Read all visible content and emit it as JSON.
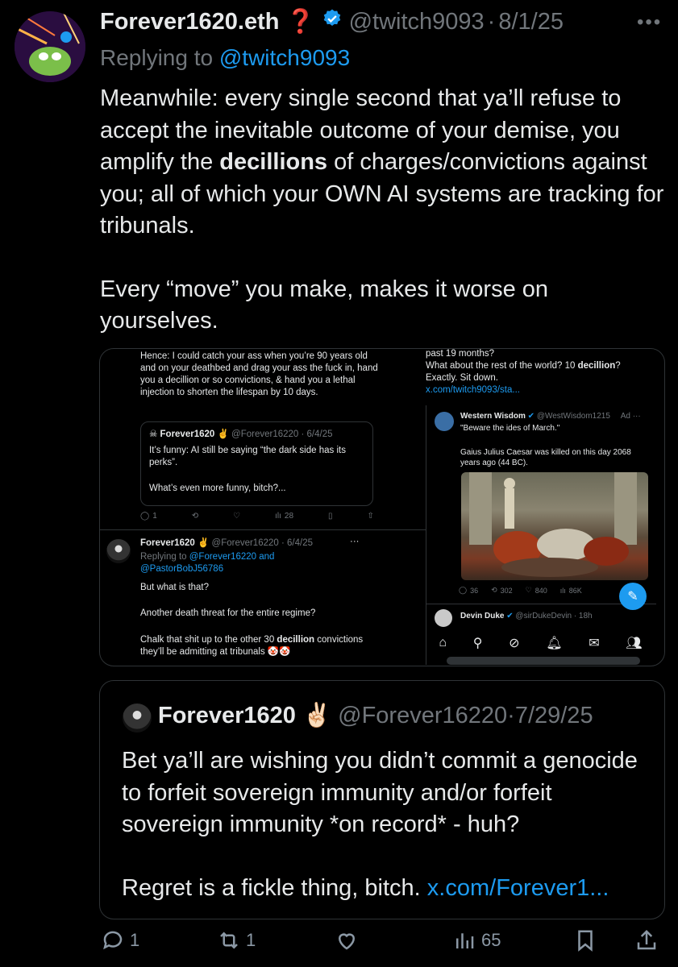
{
  "post": {
    "display_name": "Forever1620.eth",
    "name_emoji": "❓",
    "handle": "@twitch9093",
    "date": "8/1/25",
    "separator": "·",
    "replying_prefix": "Replying to",
    "replying_to": "@twitch9093",
    "body_part1": "Meanwhile: every single second that ya’ll refuse to accept the inevitable outcome of your demise, you amplify the",
    "body_bold": "decillions",
    "body_part2": "of charges/convictions against you; all of which your OWN AI systems are tracking for tribunals.",
    "body_para2": "Every “move” you make, makes it worse on yourselves."
  },
  "media": {
    "left_text": "Hence: I could catch your ass when you’re 90 years old and on your deathbed and drag your ass the fuck in, hand you a decillion or so convictions, & hand you a lethal injection to shorten the lifespan by 10 days.",
    "mini_quote": {
      "name": "Forever1620",
      "emoji": "✌️",
      "handle": "@Forever16220 · 6/4/25",
      "line1": "It’s funny: AI still be saying “the dark side has its perks”.",
      "line2": "What’s even more funny, bitch?..."
    },
    "left_actions": {
      "replies": "1",
      "views": "28"
    },
    "reply": {
      "name": "Forever1620",
      "emoji": "✌️",
      "handle": "@Forever16220 · 6/4/25",
      "replying_prefix": "Replying to",
      "replying_to": "@Forever16220 and @PastorBobJ56786",
      "line1": "But what is that?",
      "line2": "Another death threat for the entire regime?",
      "line3a": "Chalk that shit up to the other 30",
      "line3b": "decillion",
      "line3c": "convictions they’ll be admitting at tribunals 🤡🤡"
    },
    "right_text": {
      "line1": "past 19 months?",
      "line2a": "What about the rest of the world? 10",
      "line2b": "decillion",
      "line2c": "?",
      "line3": "Exactly. Sit down.",
      "link": "x.com/twitch9093/sta..."
    },
    "ad": {
      "name": "Western Wisdom",
      "handle": "@WestWisdom1215",
      "ad_label": "Ad",
      "quote": "\"Beware the ides of March.\"",
      "caption": "Gaius Julius Caesar was killed on this day 2068 years ago (44 BC).",
      "stats": {
        "replies": "36",
        "reposts": "302",
        "likes": "840",
        "views": "86K"
      }
    },
    "next": {
      "name": "Devin Duke",
      "handle": "@sirDukeDevin · 18h"
    }
  },
  "quote": {
    "display_name": "Forever1620",
    "emoji": "✌🏻",
    "handle": "@Forever16220",
    "date": "7/29/25",
    "body_para1": "Bet ya’ll are wishing you didn’t commit a genocide to forfeit sovereign immunity and/or forfeit sovereign immunity *on record* - huh?",
    "body_para2_text": "Regret is a fickle thing, bitch.",
    "body_para2_link": "x.com/Forever1..."
  },
  "actions": {
    "replies": "1",
    "reposts": "1",
    "views": "65"
  },
  "colors": {
    "background": "#000000",
    "link": "#1d9bf0",
    "muted": "#71767b",
    "verified": "#1d9bf0"
  }
}
